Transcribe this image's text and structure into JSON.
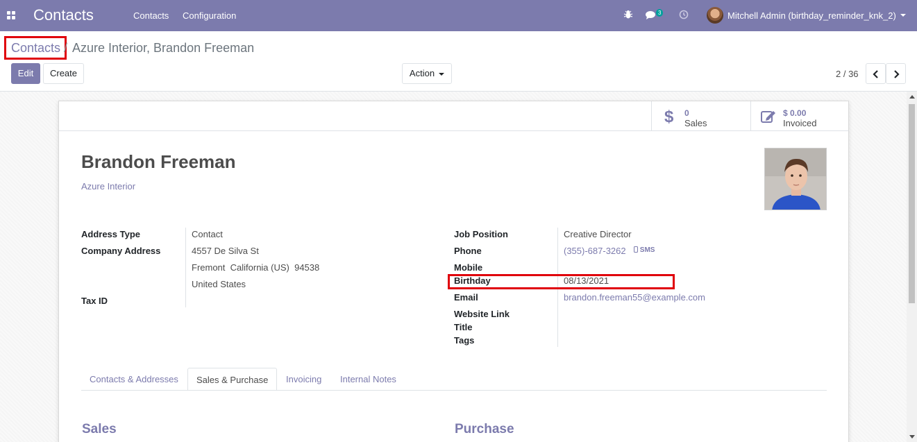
{
  "navbar": {
    "app_title": "Contacts",
    "menu": [
      "Contacts",
      "Configuration"
    ],
    "messages_badge": "3",
    "user": "Mitchell Admin (birthday_reminder_knk_2)",
    "icons": [
      "apps-icon",
      "bug-icon",
      "chat-icon",
      "clock-icon",
      "user-avatar"
    ]
  },
  "breadcrumb": {
    "parent": "Contacts",
    "separator": "/",
    "current": "Azure Interior, Brandon Freeman"
  },
  "toolbar": {
    "edit_label": "Edit",
    "create_label": "Create",
    "action_label": "Action",
    "pager": "2 / 36"
  },
  "smart_buttons": [
    {
      "value": "0",
      "label": "Sales",
      "icon": "dollar-icon"
    },
    {
      "value": "$ 0.00",
      "label": "Invoiced",
      "icon": "invoice-edit-icon"
    }
  ],
  "partner": {
    "name": "Brandon Freeman",
    "company": "Azure Interior"
  },
  "left_fields": {
    "address_type_label": "Address Type",
    "address_type": "Contact",
    "company_address_label": "Company Address",
    "street": "4557 De Silva St",
    "city_line": "Fremont  California (US)  94538",
    "country": "United States",
    "tax_id_label": "Tax ID"
  },
  "right_fields": {
    "job_position_label": "Job Position",
    "job_position": "Creative Director",
    "phone_label": "Phone",
    "phone": "(355)-687-3262",
    "sms_label": "SMS",
    "mobile_label": "Mobile",
    "birthday_label": "Birthday",
    "birthday": "08/13/2021",
    "email_label": "Email",
    "email": "brandon.freeman55@example.com",
    "website_label": "Website Link",
    "title_label": "Title",
    "tags_label": "Tags"
  },
  "tabs": [
    "Contacts & Addresses",
    "Sales & Purchase",
    "Invoicing",
    "Internal Notes"
  ],
  "active_tab": "Sales & Purchase",
  "sections": {
    "sales": "Sales",
    "purchase": "Purchase"
  },
  "colors": {
    "brand": "#7c7bad",
    "highlight": "#e0000b"
  }
}
